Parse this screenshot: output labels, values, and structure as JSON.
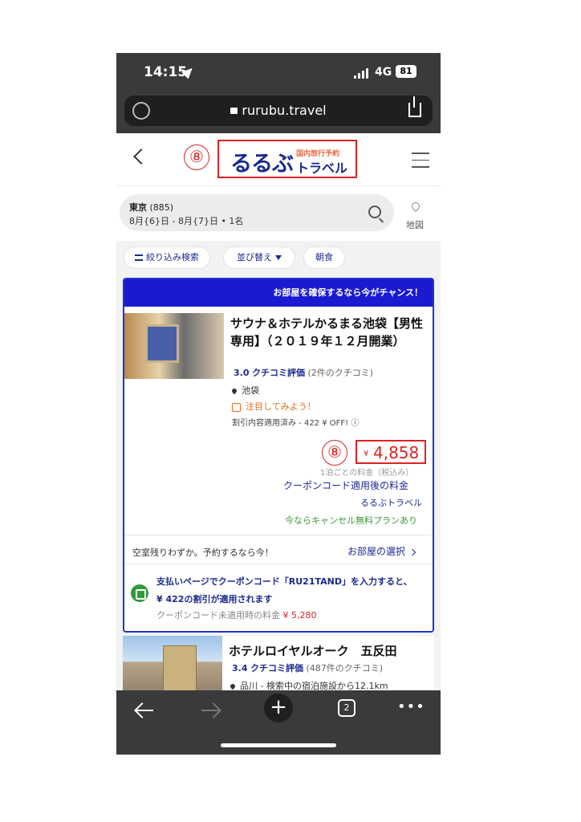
{
  "status_bar": {
    "time": "14:15",
    "network": "4G",
    "battery": "81"
  },
  "browser": {
    "url": "rurubu.travel"
  },
  "header": {
    "annotation": "⑧",
    "logo_main": "るるぶ",
    "logo_sub_top": "国内旅行予約",
    "logo_sub_bottom": "トラベル"
  },
  "search": {
    "destination": "東京",
    "count": "(885)",
    "details": "8月{6}日 - 8月{7}日 • 1名",
    "map_label": "地図"
  },
  "filters": {
    "refine_label": "絞り込み検索",
    "sort_label": "並び替え",
    "breakfast_label": "朝食"
  },
  "hotel1": {
    "banner": "お部屋を確保するなら今がチャンス！",
    "name": "サウナ＆ホテルかるまる池袋【男性専用】（２０１９年１２月開業）",
    "score": "3.0",
    "score_label": "クチコミ評価",
    "reviews": "(2件のクチコミ)",
    "area": "池袋",
    "promo": "注目してみよう！",
    "discount": "割引内容適用済み - 422 ¥ OFF! ⓘ",
    "annotation": "⑧",
    "currency": "¥",
    "price": "4,858",
    "per_night": "1泊ごとの料金（税込み）",
    "coupon_price_link": "クーポンコード適用後の料金",
    "brand": "るるぶトラベル",
    "cancel": "今ならキャンセル無料プランあり",
    "availability": "空室残りわずか。予約するなら今！",
    "select_room": "お部屋の選択",
    "coupon_line1": "支払いページでクーポンコード「RU21TAND」を入力すると、",
    "coupon_line2": "¥ 422の割引が適用されます",
    "coupon_orig_label": "クーポンコード未適用時の料金",
    "coupon_orig_price": "¥ 5,280"
  },
  "hotel2": {
    "name": "ホテルロイヤルオーク　五反田",
    "score": "3.4",
    "score_label": "クチコミ評価",
    "reviews": "(487件のクチコミ)",
    "area": "品川 - 検索中の宿泊施設から12.1km"
  },
  "toolbar": {
    "new_tab": "+",
    "tab_count": "2",
    "more": "•••"
  },
  "icons": {
    "location": "location-arrow-icon",
    "lock": "lock-icon",
    "share": "share-icon",
    "menu": "hamburger-icon",
    "search": "search-icon",
    "map": "map-pin-icon",
    "coupon": "tag-icon"
  },
  "colors": {
    "brand_blue": "#1b2a8f",
    "banner_blue": "#1a1ad0",
    "annotation_red": "#dd2222",
    "cancel_green": "#3a9a3a"
  }
}
